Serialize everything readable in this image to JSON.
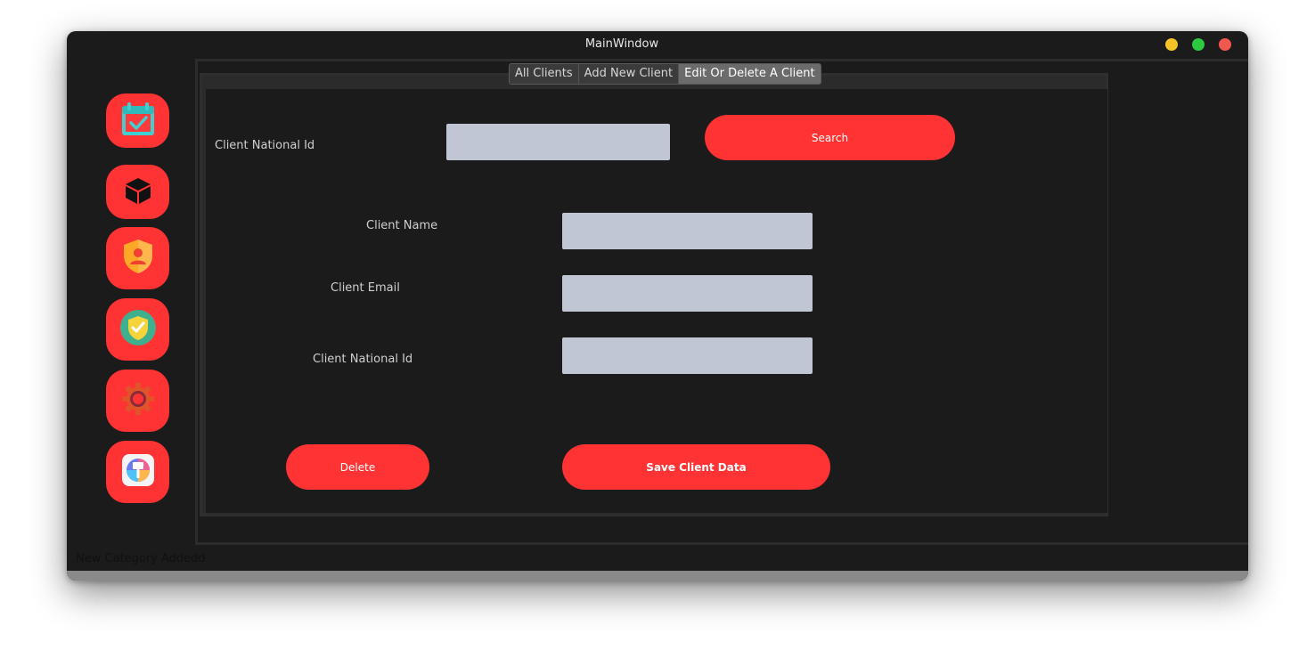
{
  "window": {
    "title": "MainWindow"
  },
  "sidebar": {
    "items": [
      {
        "icon": "calendar-check-icon"
      },
      {
        "icon": "cube-icon"
      },
      {
        "icon": "shield-user-icon"
      },
      {
        "icon": "shield-check-icon"
      },
      {
        "icon": "gear-icon"
      },
      {
        "icon": "paint-brush-icon"
      }
    ]
  },
  "tabs": [
    {
      "label": "All Clients"
    },
    {
      "label": "Add New Client"
    },
    {
      "label": "Edit Or Delete A Client"
    }
  ],
  "form": {
    "search_label": "Client National Id",
    "search_value": "",
    "search_button": "Search",
    "name_label": "Client Name",
    "name_value": "",
    "email_label": "Client Email",
    "email_value": "",
    "national_id_label": "Client National Id",
    "national_id_value": "",
    "delete_button": "Delete",
    "save_button": "Save Client Data"
  },
  "status_text": "New Category Addedd",
  "colors": {
    "window_bg": "#1b1b1b",
    "accent": "#ff3333",
    "field_bg": "#c1c6d5"
  }
}
